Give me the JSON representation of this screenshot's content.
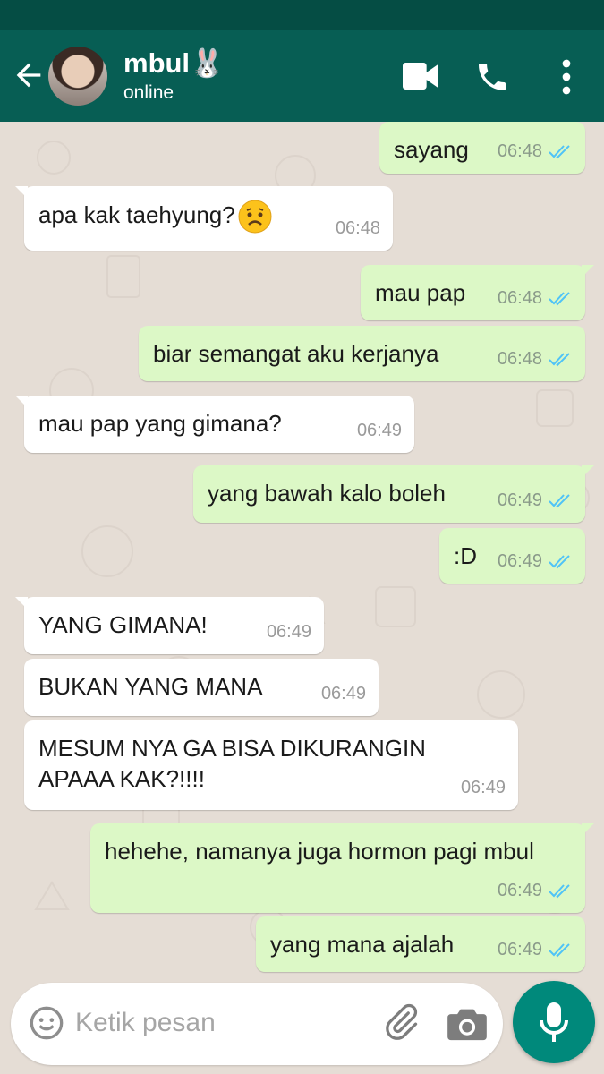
{
  "header": {
    "contact_name": "mbul🐰",
    "status": "online"
  },
  "messages": [
    {
      "dir": "out",
      "text": "sayang",
      "time": "06:48"
    },
    {
      "dir": "in",
      "text": "apa kak taehyung?",
      "emoji": "😟",
      "time": "06:48"
    },
    {
      "dir": "out",
      "text": "mau pap",
      "time": "06:48"
    },
    {
      "dir": "out",
      "text": "biar semangat aku kerjanya",
      "time": "06:48"
    },
    {
      "dir": "in",
      "text": "mau pap yang gimana?",
      "time": "06:49"
    },
    {
      "dir": "out",
      "text": "yang bawah kalo boleh",
      "time": "06:49"
    },
    {
      "dir": "out",
      "text": ":D",
      "time": "06:49"
    },
    {
      "dir": "in",
      "text": "YANG GIMANA!",
      "time": "06:49"
    },
    {
      "dir": "in",
      "text": "BUKAN YANG MANA",
      "time": "06:49"
    },
    {
      "dir": "in",
      "text": "MESUM NYA GA BISA DIKURANGIN APAAA KAK?!!!!",
      "time": "06:49"
    },
    {
      "dir": "out",
      "text": "hehehe, namanya juga hormon pagi mbul",
      "time": "06:49"
    },
    {
      "dir": "out",
      "text": "yang mana ajalah",
      "time": "06:49"
    }
  ],
  "input": {
    "placeholder": "Ketik pesan"
  },
  "colors": {
    "header": "#075e54",
    "status_bar": "#054d44",
    "outgoing_bubble": "#dcf8c6",
    "incoming_bubble": "#ffffff",
    "read_tick": "#4fc3f7",
    "mic_button": "#00897b",
    "chat_background": "#e5ddd5"
  },
  "icons": [
    "back-arrow-icon",
    "video-call-icon",
    "phone-icon",
    "more-vert-icon",
    "double-tick-icon",
    "smiley-icon",
    "paperclip-icon",
    "camera-icon",
    "mic-icon"
  ]
}
